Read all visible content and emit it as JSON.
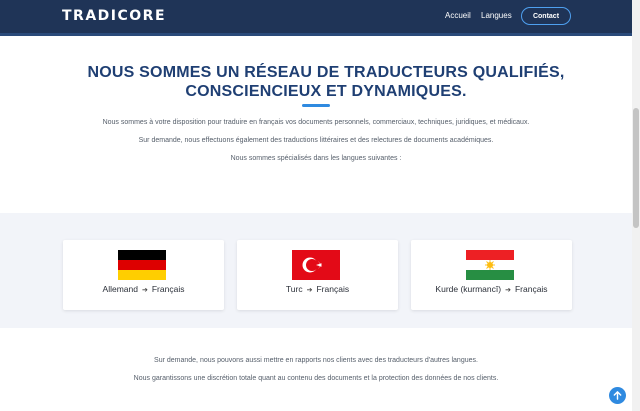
{
  "header": {
    "brand": "TRADICORE",
    "nav": {
      "accueil": "Accueil",
      "langues": "Langues",
      "contact": "Contact"
    }
  },
  "intro": {
    "headline": "NOUS SOMMES UN RÉSEAU DE TRADUCTEURS QUALIFIÉS, CONSCIENCIEUX ET DYNAMIQUES.",
    "p1": "Nous sommes à votre disposition pour traduire en français vos documents personnels, commerciaux, techniques, juridiques, et médicaux.",
    "p2": "Sur demande, nous effectuons également des traductions littéraires et des relectures de documents académiques.",
    "p3": "Nous sommes spécialisés dans les langues suivantes :"
  },
  "languages": [
    {
      "source": "Allemand",
      "target": "Français",
      "flag": "germany-flag"
    },
    {
      "source": "Turc",
      "target": "Français",
      "flag": "turkey-flag"
    },
    {
      "source": "Kurde (kurmancî)",
      "target": "Français",
      "flag": "kurdistan-flag"
    }
  ],
  "bottom": {
    "p4": "Sur demande, nous pouvons aussi mettre en rapports nos clients avec des traducteurs d'autres langues.",
    "p5": "Nous garantissons une discrétion totale quant au contenu des documents et la protection des données de nos clients."
  },
  "colors": {
    "header_bg": "#1f3457",
    "headline": "#1f3f73",
    "accent": "#2f8ae0",
    "band_bg": "#f2f4f9"
  },
  "icons": {
    "arrow": "arrow-right-icon",
    "to_top": "arrow-up-icon"
  }
}
